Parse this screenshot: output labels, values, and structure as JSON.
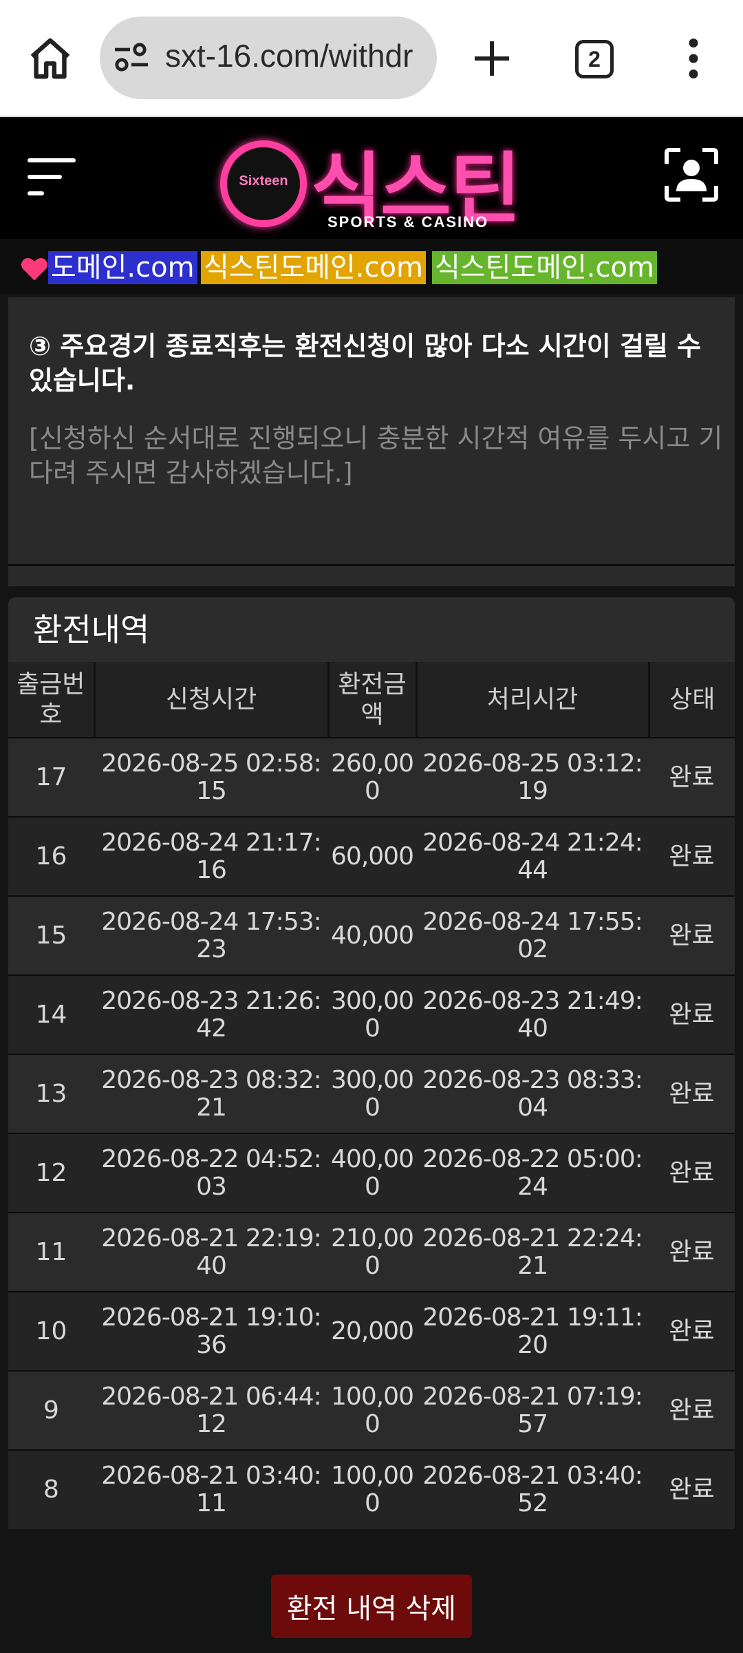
{
  "browser": {
    "url": "sxt-16.com/withdr",
    "tab_count": "2"
  },
  "site": {
    "logo_badge": "Sixteen",
    "logo_name": "식스틴",
    "logo_sub": "SPORTS & CASINO",
    "accent_color": "#ff4fae"
  },
  "domains": [
    {
      "label": "도메인.com",
      "color": "#2d2fcf"
    },
    {
      "label": "식스틴도메인.com",
      "color": "#e2a400"
    },
    {
      "label": "식스틴도메인.com",
      "color": "#67b52c"
    }
  ],
  "notice": {
    "heading": "③ 주요경기 종료직후는 환전신청이 많아 다소 시간이 걸릴 수 있습니다.",
    "desc": "[신청하신 순서대로 진행되오니 충분한 시간적 여유를 두시고 기다려 주시면 감사하겠습니다.]"
  },
  "history": {
    "title": "환전내역",
    "columns": [
      "출금번호",
      "신청시간",
      "환전금액",
      "처리시간",
      "상태"
    ],
    "rows": [
      {
        "id": "17",
        "requested": "2026-08-25 02:58:15",
        "amount": "260,000",
        "processed": "2026-08-25 03:12:19",
        "status": "완료"
      },
      {
        "id": "16",
        "requested": "2026-08-24 21:17:16",
        "amount": "60,000",
        "processed": "2026-08-24 21:24:44",
        "status": "완료"
      },
      {
        "id": "15",
        "requested": "2026-08-24 17:53:23",
        "amount": "40,000",
        "processed": "2026-08-24 17:55:02",
        "status": "완료"
      },
      {
        "id": "14",
        "requested": "2026-08-23 21:26:42",
        "amount": "300,000",
        "processed": "2026-08-23 21:49:40",
        "status": "완료"
      },
      {
        "id": "13",
        "requested": "2026-08-23 08:32:21",
        "amount": "300,000",
        "processed": "2026-08-23 08:33:04",
        "status": "완료"
      },
      {
        "id": "12",
        "requested": "2026-08-22 04:52:03",
        "amount": "400,000",
        "processed": "2026-08-22 05:00:24",
        "status": "완료"
      },
      {
        "id": "11",
        "requested": "2026-08-21 22:19:40",
        "amount": "210,000",
        "processed": "2026-08-21 22:24:21",
        "status": "완료"
      },
      {
        "id": "10",
        "requested": "2026-08-21 19:10:36",
        "amount": "20,000",
        "processed": "2026-08-21 19:11:20",
        "status": "완료"
      },
      {
        "id": "9",
        "requested": "2026-08-21 06:44:12",
        "amount": "100,000",
        "processed": "2026-08-21 07:19:57",
        "status": "완료"
      },
      {
        "id": "8",
        "requested": "2026-08-21 03:40:11",
        "amount": "100,000",
        "processed": "2026-08-21 03:40:52",
        "status": "완료"
      }
    ]
  },
  "actions": {
    "delete_label": "환전 내역 삭제"
  }
}
